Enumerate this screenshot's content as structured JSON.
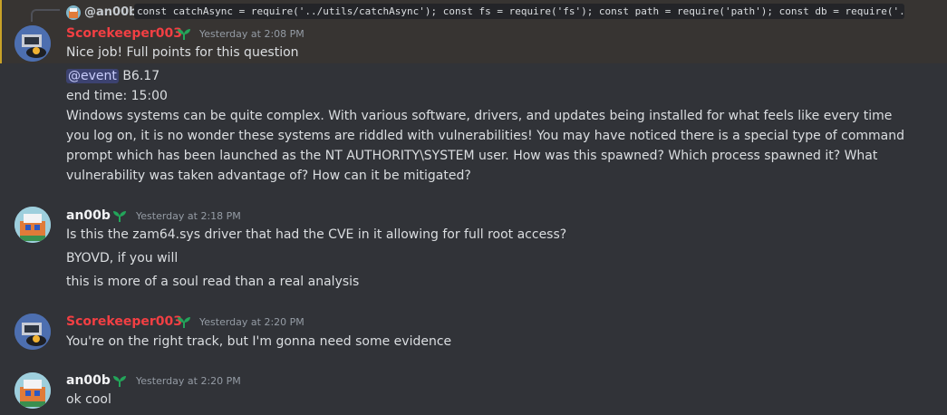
{
  "reply": {
    "name": "@an00b",
    "code": "const catchAsync = require('../utils/catchAsync'); const fs = require('fs'); const path = require('path'); const db = require('..."
  },
  "colors": {
    "scorekeeper_name": "#f23f43",
    "an00b_name": "#f2f3f5",
    "highlight_bar": "#c9a227",
    "mention_bg": "#3c4270"
  },
  "messages": [
    {
      "author": "Scorekeeper003",
      "badge": "sprout-icon",
      "timestamp": "Yesterday at 2:08 PM",
      "lines": [
        "Nice job! Full points for this question"
      ],
      "mention": "@event",
      "after_mention": " B6.17",
      "extra_lines": [
        "end time: 15:00"
      ],
      "paragraph": "Windows systems can be quite complex. With various software, drivers, and updates being installed for what feels like every time you log on, it is no wonder these systems are riddled with vulnerabilities! You may have noticed there is a special type of command prompt which has been launched as the NT AUTHORITY\\SYSTEM user. How was this spawned? Which process spawned it? What vulnerability was taken advantage of? How can it be mitigated?"
    },
    {
      "author": "an00b",
      "badge": "sprout-icon",
      "timestamp": "Yesterday at 2:18 PM",
      "lines": [
        "Is this the zam64.sys driver that had the CVE in it allowing for full root access?",
        "BYOVD, if you will",
        "this is more of a soul read than a real analysis"
      ]
    },
    {
      "author": "Scorekeeper003",
      "badge": "sprout-icon",
      "timestamp": "Yesterday at 2:20 PM",
      "lines": [
        "You're on the right track, but I'm gonna need some evidence"
      ]
    },
    {
      "author": "an00b",
      "badge": "sprout-icon",
      "timestamp": "Yesterday at 2:20 PM",
      "lines": [
        "ok cool"
      ]
    }
  ]
}
